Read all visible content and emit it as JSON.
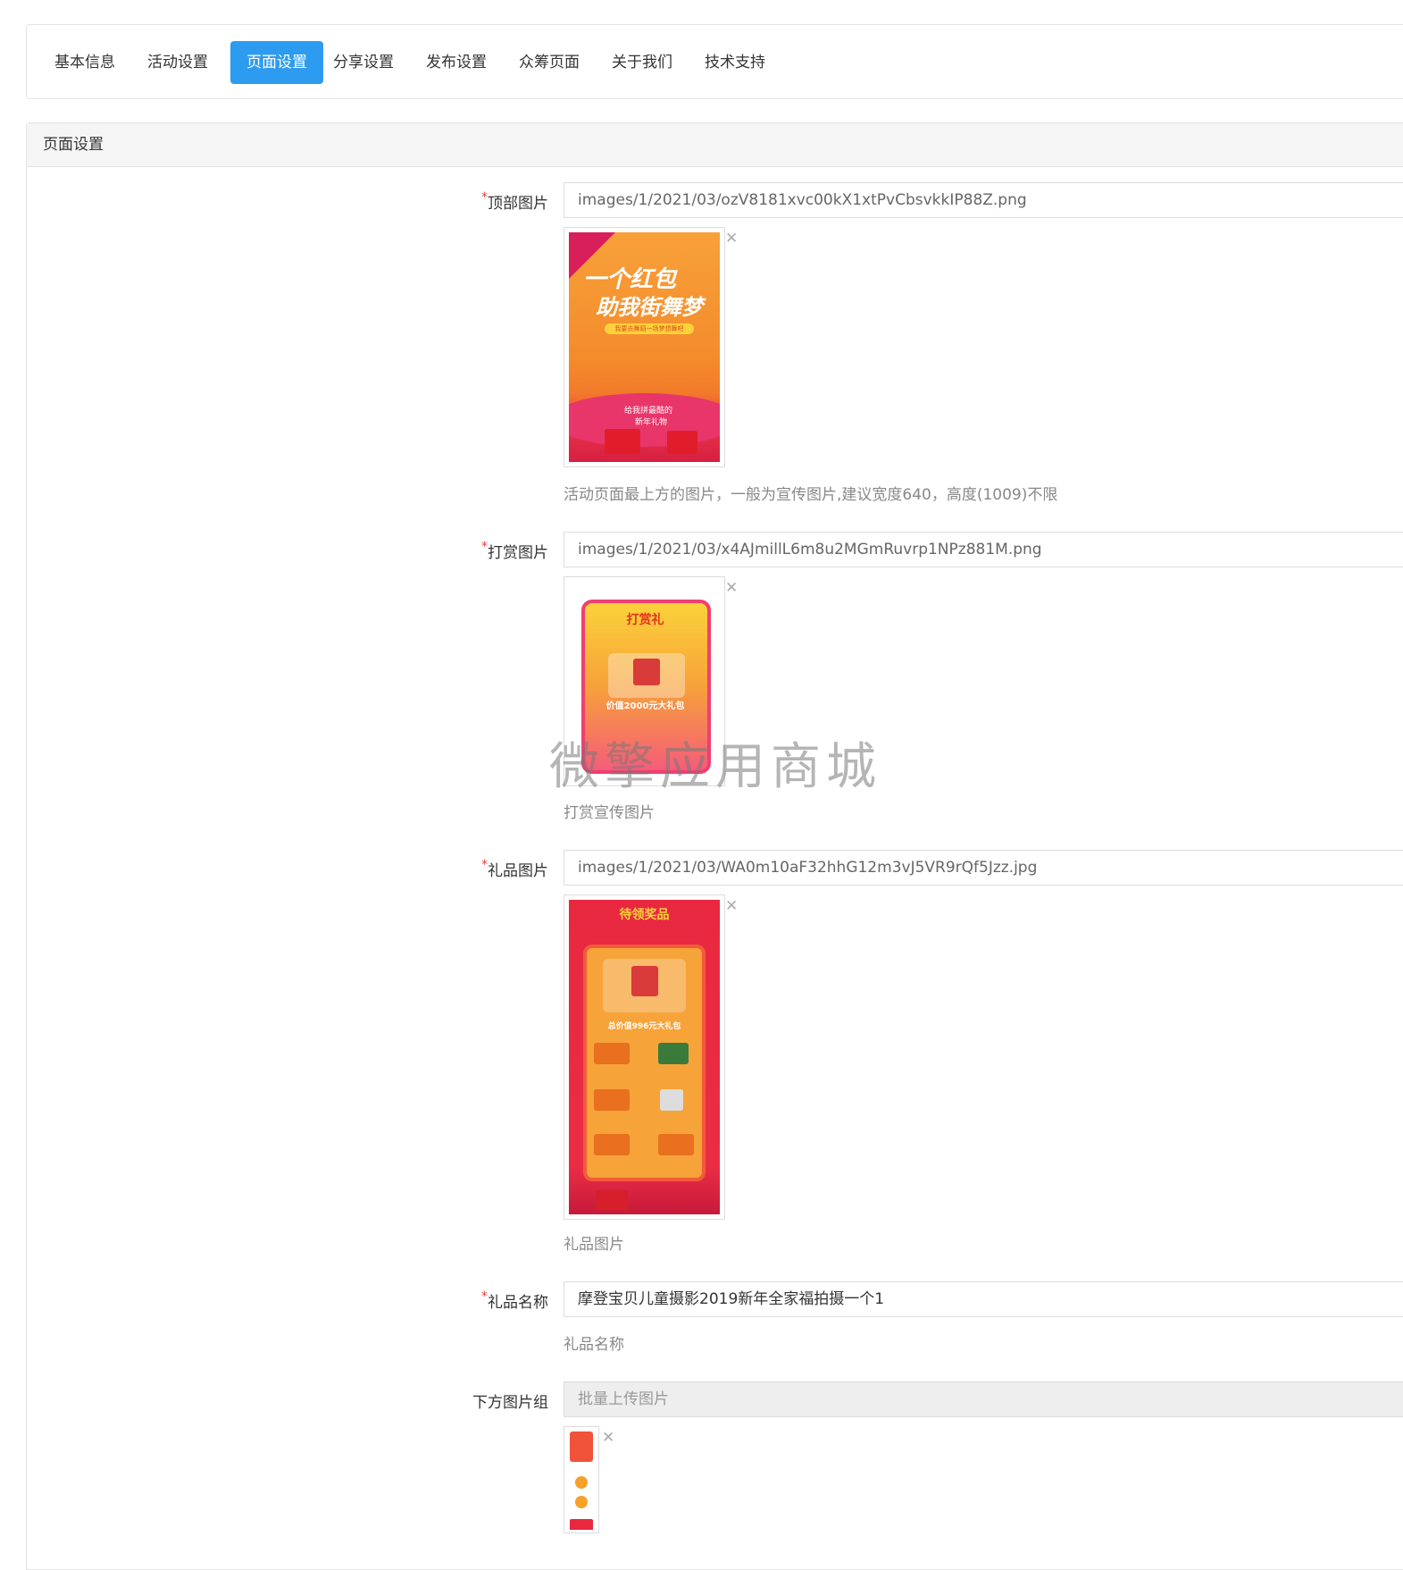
{
  "tabs": [
    {
      "label": "基本信息",
      "active": false
    },
    {
      "label": "活动设置",
      "active": false
    },
    {
      "label": "页面设置",
      "active": true
    },
    {
      "label": "分享设置",
      "active": false
    },
    {
      "label": "发布设置",
      "active": false
    },
    {
      "label": "众筹页面",
      "active": false
    },
    {
      "label": "关于我们",
      "active": false
    },
    {
      "label": "技术支持",
      "active": false
    }
  ],
  "panel": {
    "title": "页面设置"
  },
  "fields": {
    "top_image": {
      "required_mark": "*",
      "label": "顶部图片",
      "value": "images/1/2021/03/ozV8181xvc00kX1xtPvCbsvkkIP88Z.png",
      "help": "活动页面最上方的图片，一般为宣传图片,建议宽度640，高度(1009)不限",
      "poster": {
        "line1": "一个红包",
        "line2": "助我街舞梦",
        "banner": "我要去舞蹈一场梦想舞吧",
        "bottom1": "给我拼最酷的",
        "bottom2": "新年礼物"
      }
    },
    "reward_image": {
      "required_mark": "*",
      "label": "打赏图片",
      "value": "images/1/2021/03/x4AJmillL6m8u2MGmRuvrp1NPz881M.png",
      "help": "打赏宣传图片",
      "poster": {
        "title": "打赏礼",
        "price": "价值2000元大礼包"
      }
    },
    "gift_image": {
      "required_mark": "*",
      "label": "礼品图片",
      "value": "images/1/2021/03/WA0m10aF32hhG12m3vJ5VR9rQf5Jzz.jpg",
      "help": "礼品图片",
      "poster": {
        "title": "待领奖品",
        "price": "总价值996元大礼包"
      }
    },
    "gift_name": {
      "required_mark": "*",
      "label": "礼品名称",
      "value": "摩登宝贝儿童摄影2019新年全家福拍摄一个1",
      "help": "礼品名称"
    },
    "bottom_images": {
      "label": "下方图片组",
      "button_label": "批量上传图片"
    }
  },
  "close_glyph": "✕",
  "watermark": "微擎应用商城",
  "colors": {
    "accent": "#2d9bef",
    "required": "#e23d3d"
  }
}
